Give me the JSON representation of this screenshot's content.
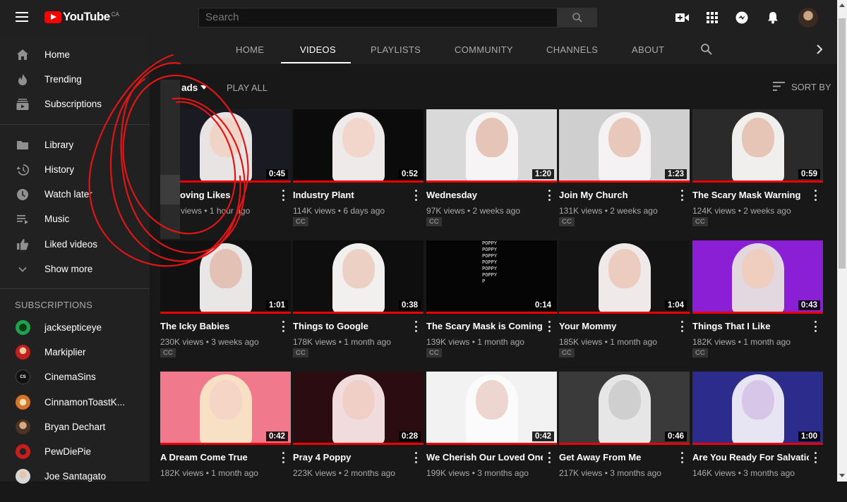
{
  "header": {
    "logo_text": "YouTube",
    "logo_country": "CA",
    "search_placeholder": "Search"
  },
  "sidebar": {
    "primary": [
      {
        "label": "Home",
        "icon": "home-icon"
      },
      {
        "label": "Trending",
        "icon": "flame-icon"
      },
      {
        "label": "Subscriptions",
        "icon": "subscriptions-icon"
      }
    ],
    "library": [
      {
        "label": "Library",
        "icon": "folder-icon"
      },
      {
        "label": "History",
        "icon": "history-icon"
      },
      {
        "label": "Watch later",
        "icon": "clock-icon"
      },
      {
        "label": "Music",
        "icon": "playlist-icon"
      },
      {
        "label": "Liked videos",
        "icon": "thumbs-up-icon"
      },
      {
        "label": "Show more",
        "icon": "chevron-down-icon"
      }
    ],
    "subscriptions_heading": "SUBSCRIPTIONS",
    "subscriptions": [
      {
        "name": "jacksepticeye",
        "color": "#1fa34a"
      },
      {
        "name": "Markiplier",
        "color": "#c21f1f"
      },
      {
        "name": "CinemaSins",
        "color": "#111111"
      },
      {
        "name": "CinnamonToastK...",
        "color": "#d9752a"
      },
      {
        "name": "Bryan Dechart",
        "color": "#6b4a34"
      },
      {
        "name": "PewDiePie",
        "color": "#c81d1d"
      },
      {
        "name": "Joe Santagato",
        "color": "#d8d8d8"
      }
    ]
  },
  "tabs": [
    {
      "label": "HOME"
    },
    {
      "label": "VIDEOS"
    },
    {
      "label": "PLAYLISTS"
    },
    {
      "label": "COMMUNITY"
    },
    {
      "label": "CHANNELS"
    },
    {
      "label": "ABOUT"
    }
  ],
  "toolbar": {
    "filter_label": "ads",
    "play_all": "PLAY ALL",
    "sort_by": "SORT BY"
  },
  "videos": [
    {
      "title": "oving Likes",
      "meta": "views • 1 hour ago",
      "duration": "0:45",
      "cc": "",
      "bg": "#1a1a22",
      "hair": "#e8e4e4",
      "face": "#f0d4c8"
    },
    {
      "title": "Industry Plant",
      "meta": "114K views • 6 days ago",
      "duration": "0:52",
      "cc": "CC",
      "bg": "#0b0b0b",
      "hair": "#efeaea",
      "face": "#f2d6cc"
    },
    {
      "title": "Wednesday",
      "meta": "97K views • 2 weeks ago",
      "duration": "1:20",
      "cc": "CC",
      "bg": "#d9d9d9",
      "hair": "#f6f4f4",
      "face": "#e5c5b8"
    },
    {
      "title": "Join My Church",
      "meta": "131K views • 2 weeks ago",
      "duration": "1:23",
      "cc": "CC",
      "bg": "#cfcfcf",
      "hair": "#f4f2f2",
      "face": "#e9c8bc"
    },
    {
      "title": "The Scary Mask Warning",
      "meta": "124K views • 2 weeks ago",
      "duration": "0:59",
      "cc": "CC",
      "bg": "#2a2a2a",
      "hair": "#f1eeee",
      "face": "#e6c4b6"
    },
    {
      "title": "The Icky Babies",
      "meta": "230K views • 3 weeks ago",
      "duration": "1:01",
      "cc": "CC",
      "bg": "#111111",
      "hair": "#e9e6e6",
      "face": "#e3c1b4"
    },
    {
      "title": "Things to Google",
      "meta": "178K views • 1 month ago",
      "duration": "0:38",
      "cc": "CC",
      "bg": "#0e0e0e",
      "hair": "#f2efef",
      "face": "#edd0c4"
    },
    {
      "title": "The Scary Mask is Coming",
      "meta": "139K views • 1 month ago",
      "duration": "0:14",
      "cc": "CC",
      "bg": "#050505",
      "hair": "",
      "face": ""
    },
    {
      "title": "Your Mommy",
      "meta": "185K views • 1 month ago",
      "duration": "1:04",
      "cc": "CC",
      "bg": "#141414",
      "hair": "#efe9e9",
      "face": "#ecccbf"
    },
    {
      "title": "Things That I Like",
      "meta": "182K views • 1 month ago",
      "duration": "0:43",
      "cc": "CC",
      "bg": "#8a1fd6",
      "hair": "#e3d8e0",
      "face": "#efcdbf"
    },
    {
      "title": "A Dream Come True",
      "meta": "182K views • 1 month ago",
      "duration": "0:42",
      "cc": "",
      "bg": "#f07a8c",
      "hair": "#f7e0c4",
      "face": "#f4d5c6"
    },
    {
      "title": "Pray 4 Poppy",
      "meta": "223K views • 2 months ago",
      "duration": "0:28",
      "cc": "",
      "bg": "#2b0c10",
      "hair": "#f0dcdc",
      "face": "#f0cfc6"
    },
    {
      "title": "We Cherish Our Loved Ones",
      "meta": "199K views • 3 months ago",
      "duration": "0:42",
      "cc": "",
      "bg": "#f2f2f2",
      "hair": "#fbfbfb",
      "face": "#ecd6cf"
    },
    {
      "title": "Get Away From Me",
      "meta": "217K views • 3 months ago",
      "duration": "0:46",
      "cc": "",
      "bg": "#3a3a3a",
      "hair": "#e6e6e6",
      "face": "#cfcfcf"
    },
    {
      "title": "Are You Ready For Salvation?",
      "meta": "146K views • 3 months ago",
      "duration": "1:00",
      "cc": "",
      "bg": "#2b2c8c",
      "hair": "#e7e4f4",
      "face": "#d8c6e8"
    }
  ],
  "poppy_text": [
    "POPPY",
    "POPPY",
    "POPPY",
    "POPPY",
    "POPPY",
    "POPPY",
    "P"
  ],
  "colors": {
    "accent": "#ff0000",
    "progress": "#e00000",
    "scribble": "#e01515"
  }
}
